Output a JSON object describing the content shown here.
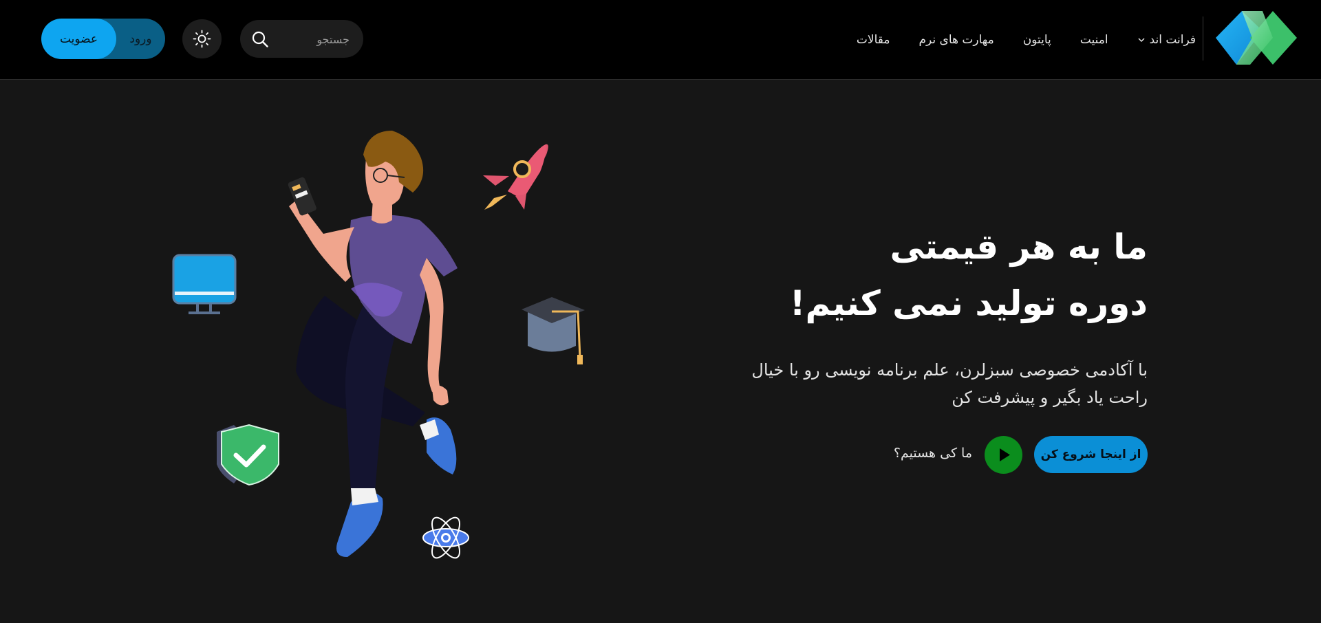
{
  "header": {
    "logo": {
      "icon": "sabzlearn-logo-icon",
      "colors": [
        "#1a9fe0",
        "#3cc06a"
      ]
    },
    "nav_items": [
      {
        "label": "فرانت اند",
        "has_dropdown": true
      },
      {
        "label": "امنیت"
      },
      {
        "label": "پایتون"
      },
      {
        "label": "مهارت های نرم"
      },
      {
        "label": "مقالات"
      }
    ],
    "search": {
      "placeholder": "جستجو",
      "value": ""
    },
    "theme_toggle_icon": "sun-icon",
    "auth": {
      "login_label": "ورود",
      "signup_label": "عضویت"
    }
  },
  "hero": {
    "title_line1": "ما به هر قیمتی",
    "title_line2": "دوره تولید نمی کنیم!",
    "description_line1": "با آکادمی خصوصی سبزلرن، علم برنامه نویسی رو با خیال",
    "description_line2": "راحت یاد بگیر و پیشرفت کن",
    "start_button": "از اینجا شروع کن",
    "play_icon": "play-icon",
    "who_link": "ما کی هستیم؟"
  },
  "colors": {
    "background": "#161616",
    "header_bg": "#000000",
    "accent_blue": "#0ea5f0",
    "play_green": "#0b8d1d"
  }
}
